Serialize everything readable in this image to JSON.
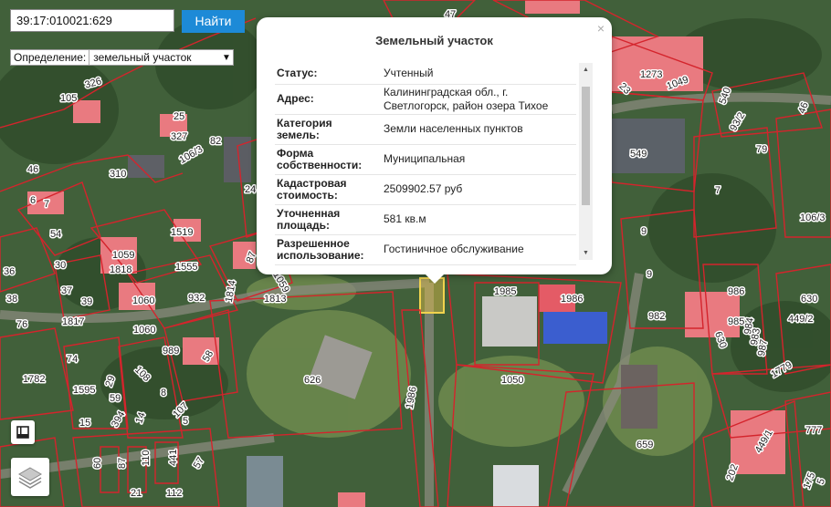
{
  "search": {
    "value": "39:17:010021:629",
    "button": "Найти"
  },
  "definition": {
    "label": "Определение:",
    "selected": "земельный участок"
  },
  "popup": {
    "title": "Земельный участок",
    "close": "×",
    "rows": [
      {
        "k1": "Статус:",
        "v1": "Учтенный"
      },
      {
        "k1": "Адрес:",
        "v1": "Калининградская обл., г.",
        "v2": "Светлогорск, район озера Тихое"
      },
      {
        "k1": "Категория",
        "k2": "земель:",
        "v1": "Земли населенных пунктов"
      },
      {
        "k1": "Форма",
        "k2": "собственности:",
        "v1": "Муниципальная"
      },
      {
        "k1": "Кадастровая",
        "k2": "стоимость:",
        "v1": "2509902.57 руб"
      },
      {
        "k1": "Уточненная",
        "k2": "площадь:",
        "v1": "581 кв.м"
      },
      {
        "k1": "Разрешенное",
        "k2": "использование:",
        "v1": "Гостиничное обслуживание"
      }
    ]
  },
  "map": {
    "labels": [
      "47",
      "326",
      "105",
      "25",
      "327",
      "106/3",
      "82",
      "24",
      "46",
      "310",
      "7",
      "6",
      "54",
      "30",
      "36",
      "38",
      "37",
      "39",
      "76",
      "1817",
      "1519",
      "1059",
      "1818",
      "1555",
      "1060",
      "932",
      "1814",
      "87",
      "1813",
      "1059",
      "1060",
      "989",
      "58",
      "74",
      "1782",
      "29",
      "1595",
      "59",
      "15",
      "394",
      "14",
      "108",
      "107",
      "5",
      "8",
      "21",
      "112",
      "110",
      "441",
      "57",
      "60",
      "87",
      "626",
      "1986",
      "1985",
      "1986",
      "1050",
      "1273",
      "1049",
      "23",
      "540",
      "93/2",
      "46",
      "549",
      "79",
      "7",
      "106/3",
      "9",
      "9",
      "982",
      "986",
      "985",
      "984",
      "983",
      "987",
      "630",
      "630",
      "449/2",
      "1779",
      "659",
      "449/1",
      "202",
      "777",
      "175",
      "5"
    ]
  },
  "colors": {
    "accent": "#1d8ad7",
    "parcel": "#d4242c",
    "building": "#e97a80"
  }
}
